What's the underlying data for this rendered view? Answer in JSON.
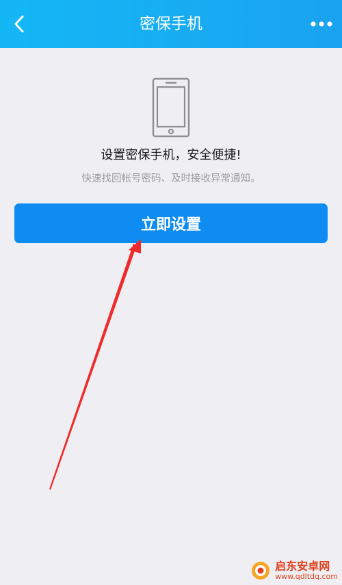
{
  "header": {
    "title": "密保手机",
    "back_icon": "chevron-left-icon",
    "more_icon": "more-dots-icon",
    "background_color": "#14b7f5"
  },
  "main": {
    "illustration_icon": "phone-icon",
    "headline": "设置密保手机，安全便捷!",
    "subline": "快速找回帐号密码、及时接收异常通知。",
    "primary_button_label": "立即设置",
    "primary_button_color": "#0f8cf1"
  },
  "annotation": {
    "arrow_color": "#f02a2a"
  },
  "watermark": {
    "name": "启东安卓网",
    "url": "www.qdltdq.com"
  }
}
